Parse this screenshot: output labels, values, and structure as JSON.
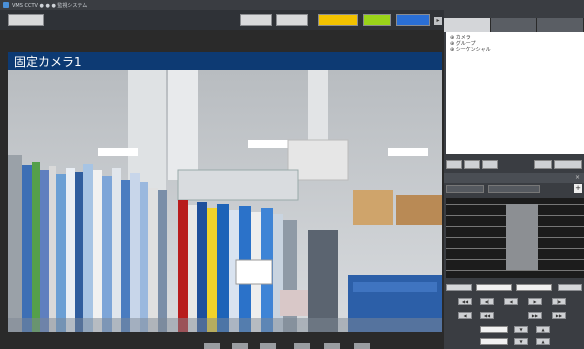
{
  "window": {
    "title": "VMS CCTV ● ● ● 監視システム"
  },
  "toolbar": {
    "left_button": "",
    "buttons": [
      {
        "label": "",
        "style": "gray"
      },
      {
        "label": "",
        "style": "gray"
      },
      {
        "label": "",
        "style": "yellow"
      },
      {
        "label": "",
        "style": "green"
      },
      {
        "label": "",
        "style": "blue"
      }
    ]
  },
  "camera": {
    "title": "固定カメラ1"
  },
  "right_panel": {
    "tabs": [
      "",
      "",
      ""
    ],
    "tree_items": [
      "カメラ",
      "グループ",
      "シーケンシャル"
    ],
    "tree_buttons": [
      "",
      "",
      "",
      "",
      ""
    ],
    "playback": {
      "title": "",
      "options": [
        "",
        ""
      ]
    }
  }
}
